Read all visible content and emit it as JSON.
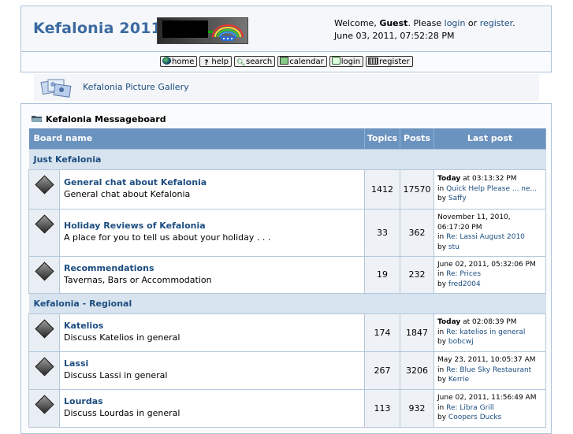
{
  "header": {
    "site_title": "Kefalonia 2011",
    "welcome_prefix": "Welcome, ",
    "guest": "Guest",
    "please": ". Please ",
    "login": "login",
    "or": " or ",
    "register": "register",
    "period": ".",
    "datetime": "June 03, 2011, 07:52:28 PM"
  },
  "menu": [
    {
      "label": "home",
      "icon": "globe-icon"
    },
    {
      "label": "help",
      "icon": "help-icon"
    },
    {
      "label": "search",
      "icon": "search-icon"
    },
    {
      "label": "calendar",
      "icon": "calendar-icon"
    },
    {
      "label": "login",
      "icon": "login-icon"
    },
    {
      "label": "register",
      "icon": "register-icon"
    }
  ],
  "gallery": {
    "link": "Kefalonia Picture Gallery",
    "icon": "gallery-icon"
  },
  "board": {
    "title": "Kefalonia Messageboard",
    "columns": {
      "name": "Board name",
      "topics": "Topics",
      "posts": "Posts",
      "last": "Last post"
    },
    "categories": [
      {
        "name": "Just Kefalonia",
        "boards": [
          {
            "name": "General chat about Kefalonia",
            "desc": "General chat about Kefalonia",
            "topics": "1412",
            "posts": "17570",
            "last_date": "Today",
            "last_time": " at 03:13:32 PM",
            "in": "in ",
            "last_topic": "Quick Help Please ... ne...",
            "by": "by ",
            "last_user": "Saffy"
          },
          {
            "name": "Holiday Reviews of Kefalonia",
            "desc": "A place for you to tell us about your holiday . . .",
            "topics": "33",
            "posts": "362",
            "last_date": "",
            "last_time": "November 11, 2010, 06:17:20 PM",
            "in": "in ",
            "last_topic": "Re: Lassi August 2010",
            "by": "by ",
            "last_user": "stu"
          },
          {
            "name": "Recommendations",
            "desc": "Tavernas, Bars or Accommodation",
            "topics": "19",
            "posts": "232",
            "last_date": "",
            "last_time": "June 02, 2011, 05:32:06 PM",
            "in": "in ",
            "last_topic": "Re: Prices",
            "by": "by ",
            "last_user": "fred2004"
          }
        ]
      },
      {
        "name": "Kefalonia - Regional",
        "boards": [
          {
            "name": "Katelios",
            "desc": "Discuss Katelios in general",
            "topics": "174",
            "posts": "1847",
            "last_date": "Today",
            "last_time": " at 02:08:39 PM",
            "in": "in ",
            "last_topic": "Re: katelios in general",
            "by": "by ",
            "last_user": "bobcwj"
          },
          {
            "name": "Lassi",
            "desc": "Discuss Lassi in general",
            "topics": "267",
            "posts": "3206",
            "last_date": "",
            "last_time": "May 23, 2011, 10:05:37 AM",
            "in": "in ",
            "last_topic": "Re: Blue Sky Restaurant",
            "by": "by ",
            "last_user": "Kerrie"
          },
          {
            "name": "Lourdas",
            "desc": "Discuss Lourdas in general",
            "topics": "113",
            "posts": "932",
            "last_date": "",
            "last_time": "June 02, 2011, 11:56:49 AM",
            "in": "in ",
            "last_topic": "Re: Libra Grill",
            "by": "by ",
            "last_user": "Coopers Ducks"
          }
        ]
      }
    ]
  }
}
